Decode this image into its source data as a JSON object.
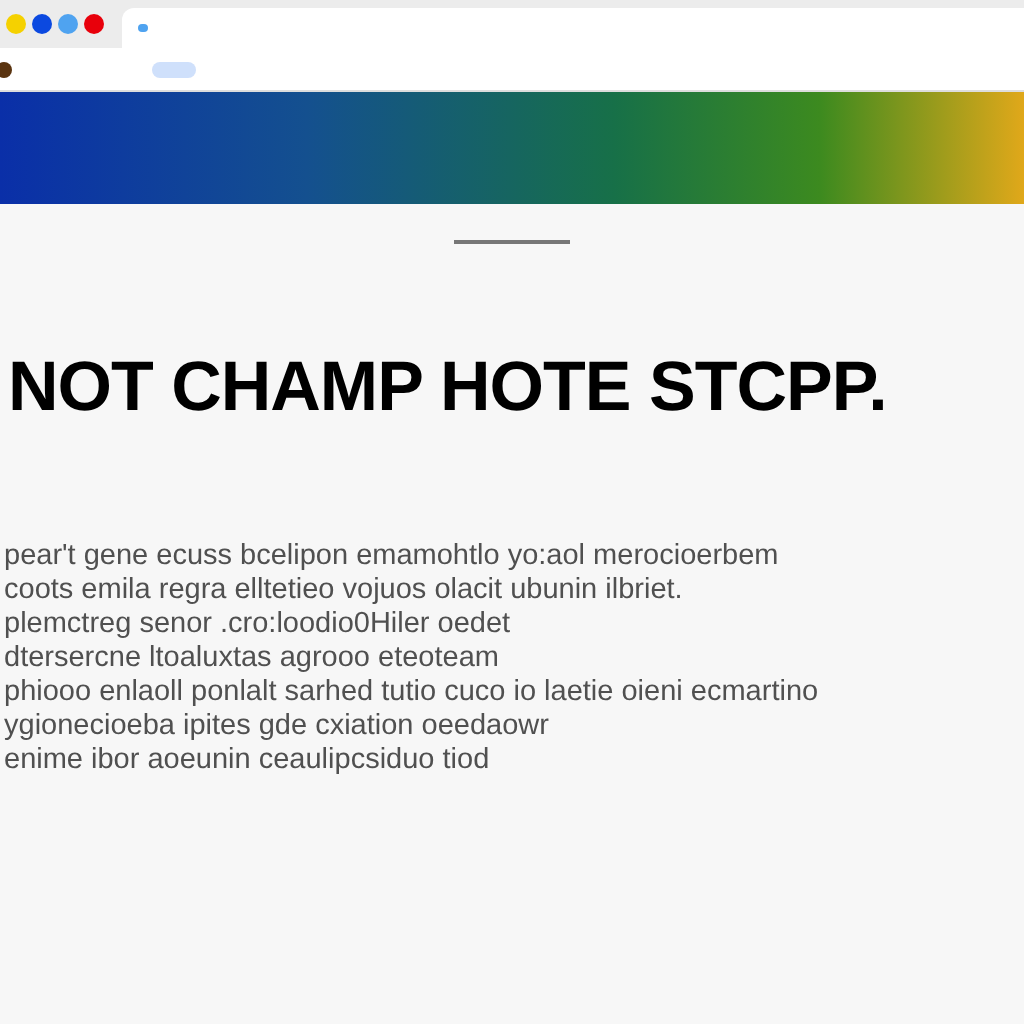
{
  "browser": {
    "window_dots": [
      {
        "color": "#f5d100"
      },
      {
        "color": "#0b49e0"
      },
      {
        "color": "#4fa3f0"
      },
      {
        "color": "#e8000b"
      }
    ]
  },
  "page": {
    "headline": "NOT CHAMP HOTE STCPP.",
    "paragraph_lines": [
      "pear't gene ecuss bcelipon emamohtlo yo:aol merocioerbem",
      "coots emila regra elltetieo vojuos olacit ubunin ilbriet.",
      "plemctreg senor .cro:loodio0Hiler oedet",
      "dtersercne ltoaluxtas agrooo eteoteam",
      "phiooo enlaoll ponlalt sarhed tutio cuco io laetie oieni ecmartino",
      "ygionecioeba ipites gde cxiation oeedaowr",
      "enime ibor aoeunin ceaulipcsiduo tiod"
    ]
  }
}
